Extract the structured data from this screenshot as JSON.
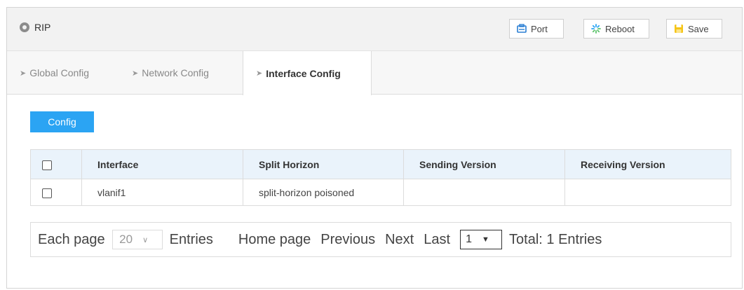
{
  "header": {
    "title": "RIP",
    "buttons": {
      "port": "Port",
      "reboot": "Reboot",
      "save": "Save"
    }
  },
  "tabs": [
    "Global Config",
    "Network Config",
    "Interface Config"
  ],
  "config_button": "Config",
  "table": {
    "columns": [
      "Interface",
      "Split Horizon",
      "Sending Version",
      "Receiving Version"
    ],
    "rows": [
      {
        "interface": "vlanif1",
        "split_horizon": "split-horizon poisoned",
        "sending_version": "",
        "receiving_version": ""
      }
    ]
  },
  "pagination": {
    "each_page": "Each page",
    "page_size": "20",
    "entries": "Entries",
    "home": "Home page",
    "previous": "Previous",
    "next": "Next",
    "last": "Last",
    "current_page": "1",
    "total": "Total: 1 Entries"
  },
  "colors": {
    "accent": "#2ba4f3",
    "header_bg": "#f2f2f2",
    "table_header_bg": "#eaf3fb"
  }
}
